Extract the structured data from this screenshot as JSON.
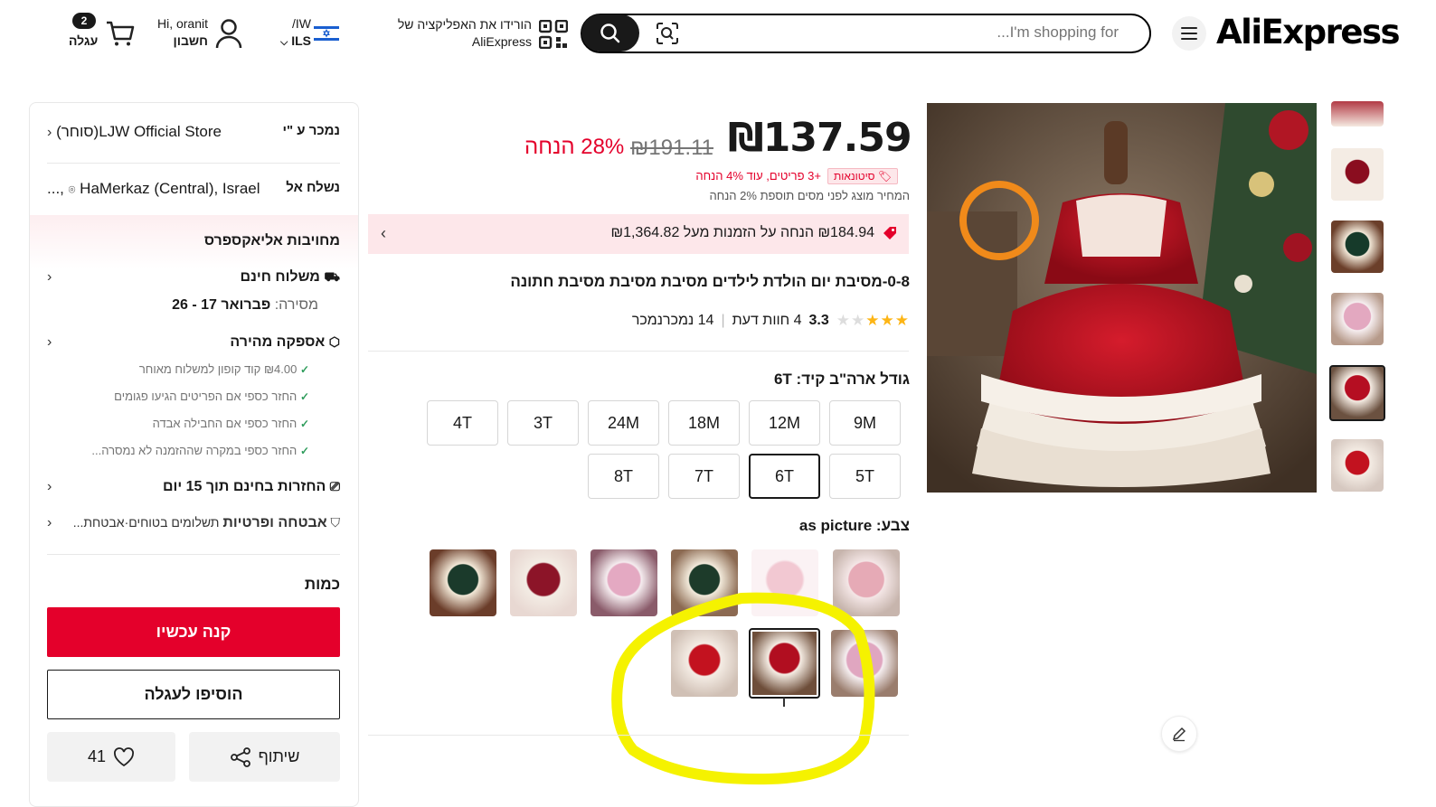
{
  "header": {
    "logo": "AliExpress",
    "search_placeholder": "...I'm shopping for",
    "app_line1": "הורידו את האפליקציה של",
    "app_line2": "AliExpress",
    "lang_line1": "/IW",
    "lang_line2": "ILS",
    "user_line1": "Hi, oranit",
    "user_line2": "חשבון",
    "cart_count": "2",
    "cart_label": "עגלה"
  },
  "product": {
    "price": "₪137.59",
    "old_price": "₪191.11",
    "discount": "28% הנחה",
    "wholesale_badge": "סיטונאות",
    "wholesale_text": "+3 פריטים, עוד 4% הנחה",
    "tax_note": "המחיר מוצג לפני מסים תוספת 2% הנחה",
    "coupon_text": "₪184.94 הנחה על הזמנות מעל ₪1,364.82",
    "title": "0-8-מסיבת יום הולדת לילדים מסיבת מסיבת מסיבת חתונה",
    "rating": "3.3",
    "reviews": "4 חוות דעת",
    "sold": "14 נמכרנמכר",
    "rating_stars": 3.3,
    "size_label": "גודל ארה\"ב קיד:",
    "size_value": "6T",
    "sizes_row1": [
      "9M",
      "12M",
      "18M",
      "24M",
      "3T",
      "4T"
    ],
    "sizes_row2": [
      "5T",
      "6T",
      "7T",
      "8T"
    ],
    "color_label": "צבע:",
    "color_value": "as picture"
  },
  "sidebar": {
    "sold_by_label": "נמכר ע \"י",
    "store": "LJW Official Store(סוחר)",
    "ship_to_label": "נשלח אל",
    "ship_to": "HaMerkaz (Central), Israel ,...",
    "commitment": "מחויבות אליאקספרס",
    "free_shipping": "משלוח חינם",
    "delivery_label": "מסירה:",
    "delivery_dates": "פברואר 17 - 26",
    "fast_delivery": "אספקה מהירה",
    "checks": [
      "₪4.00 קוד קופון למשלוח מאוחר",
      "החזר כספי אם הפריטים הגיעו פגומים",
      "החזר כספי אם החבילה אבדה",
      "החזר כספי במקרה שההזמנה לא נמסרה..."
    ],
    "free_returns": "החזרות בחינם תוך 15 יום",
    "security_bold": "אבטחה ופרטיות",
    "security_rest": "תשלומים בטוחים·אבטחת...",
    "quantity_label": "כמות",
    "buy_now": "קנה עכשיו",
    "add_to_cart": "הוסיפו לעגלה",
    "share": "שיתוף",
    "wishlist_count": "41"
  },
  "colors": {
    "accent_red": "#e4002b",
    "price_red": "#e4002b",
    "dark": "#191919",
    "highlight_yellow": "#f5f200"
  }
}
